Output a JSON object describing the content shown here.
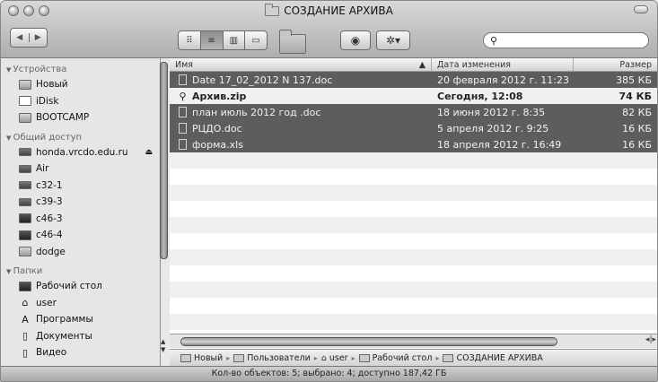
{
  "window": {
    "title": "СОЗДАНИЕ АРХИВА"
  },
  "search": {
    "value": "",
    "placeholder": ""
  },
  "toolbar": {
    "back_icon": "◀",
    "forward_icon": "▶",
    "view_icons": [
      "⠿",
      "≡",
      "▥",
      "▭"
    ],
    "eye_icon": "◉",
    "gear_icon": "✲▾",
    "search_icon": "⚲"
  },
  "sidebar": {
    "groups": [
      {
        "label": "Устройства",
        "items": [
          "Новый",
          "iDisk",
          "BOOTCAMP"
        ]
      },
      {
        "label": "Общий доступ",
        "items": [
          "honda.vrcdo.edu.ru",
          "Air",
          "c32-1",
          "c39-3",
          "c46-3",
          "c46-4",
          "dodge"
        ]
      },
      {
        "label": "Папки",
        "items": [
          "Рабочий стол",
          "user",
          "Программы",
          "Документы",
          "Видео"
        ]
      }
    ]
  },
  "list": {
    "columns": {
      "name": "Имя",
      "date": "Дата изменения",
      "size": "Размер"
    },
    "files": [
      {
        "name": "Date 17_02_2012 N 137.doc",
        "date": "20 февраля 2012 г. 11:23",
        "size": "385 КБ",
        "selected": true,
        "bold": false,
        "icon": "doc"
      },
      {
        "name": "Архив.zip",
        "date": "Сегодня, 12:08",
        "size": "74 КБ",
        "selected": false,
        "bold": true,
        "icon": "zip"
      },
      {
        "name": "план июль 2012 год .doc",
        "date": "18 июня 2012 г. 8:35",
        "size": "82 КБ",
        "selected": true,
        "bold": false,
        "icon": "doc"
      },
      {
        "name": "РЦДО.doc",
        "date": "5 апреля 2012 г. 9:25",
        "size": "16 КБ",
        "selected": true,
        "bold": false,
        "icon": "doc"
      },
      {
        "name": "форма.xls",
        "date": "18 апреля 2012 г. 16:49",
        "size": "16 КБ",
        "selected": true,
        "bold": false,
        "icon": "doc"
      }
    ]
  },
  "path": [
    "Новый",
    "Пользователи",
    "user",
    "Рабочий стол",
    "СОЗДАНИЕ АРХИВА"
  ],
  "status": "Кол-во объектов: 5; выбрано: 4; доступно 187,42 ГБ"
}
